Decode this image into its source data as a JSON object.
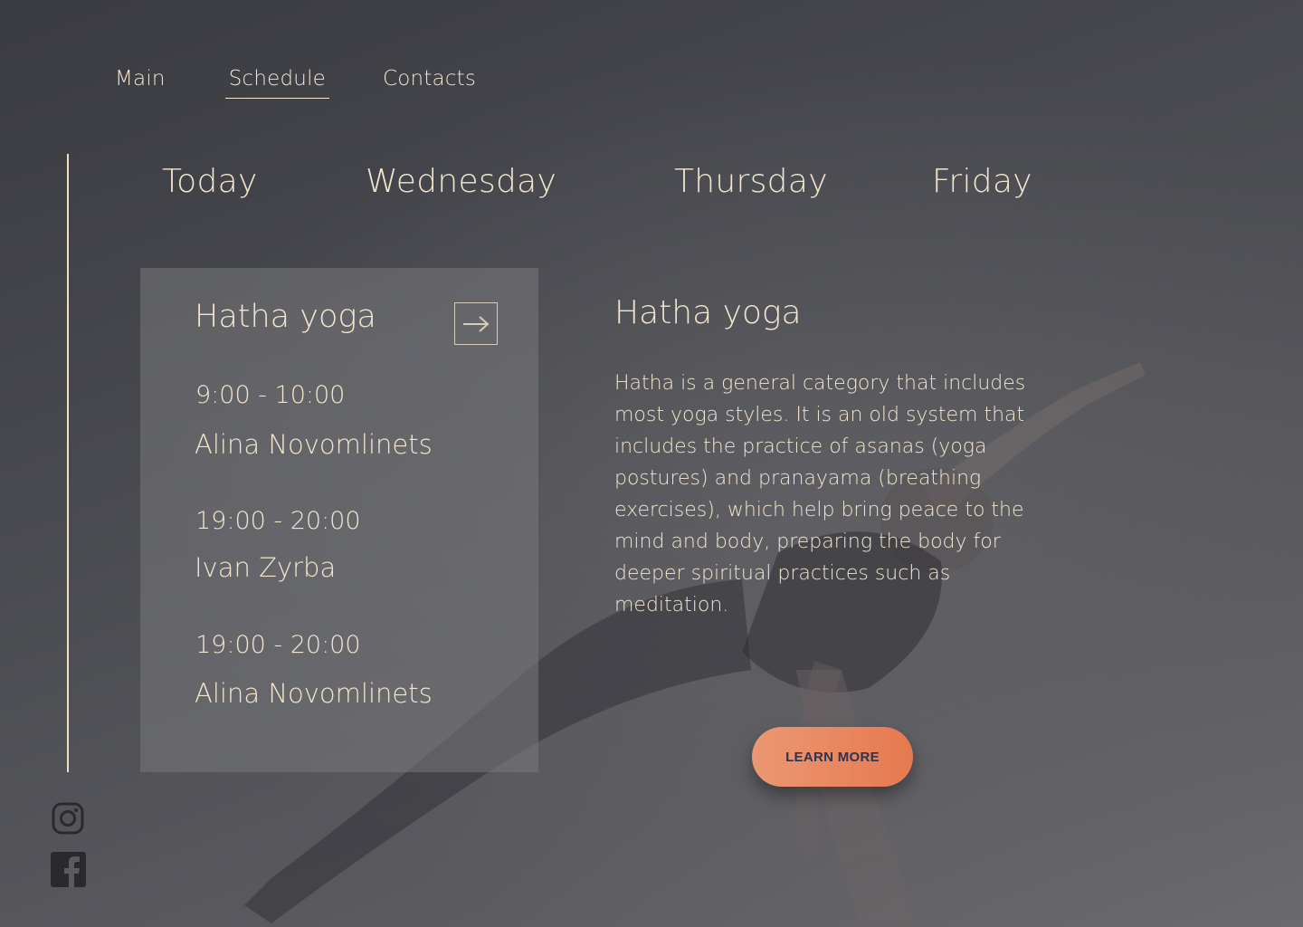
{
  "nav": {
    "items": [
      {
        "label": "Main"
      },
      {
        "label": "Schedule",
        "active": true
      },
      {
        "label": "Contacts"
      }
    ]
  },
  "days": [
    "Today",
    "Wednesday",
    "Thursday",
    "Friday"
  ],
  "card": {
    "title": "Hatha yoga",
    "slots": [
      {
        "time": "9:00 - 10:00",
        "instructor": "Alina Novomlinets"
      },
      {
        "time": "19:00 - 20:00",
        "instructor": "Ivan Zyrba"
      },
      {
        "time": "19:00 - 20:00",
        "instructor": "Alina Novomlinets"
      }
    ]
  },
  "description": {
    "title": "Hatha yoga",
    "text": "Hatha is a general category that includes most yoga styles. It is an old system that includes the practice of asanas (yoga postures) and pranayama (breathing exercises), which help bring peace to the mind and body, preparing the body for deeper spiritual practices such as meditation."
  },
  "cta": {
    "label": "LEARN MORE"
  },
  "social": {
    "icons": [
      "instagram-icon",
      "facebook-icon"
    ]
  },
  "colors": {
    "accent": "#e6794e",
    "text": "#f3e6cf",
    "button_text": "#2e3350"
  }
}
